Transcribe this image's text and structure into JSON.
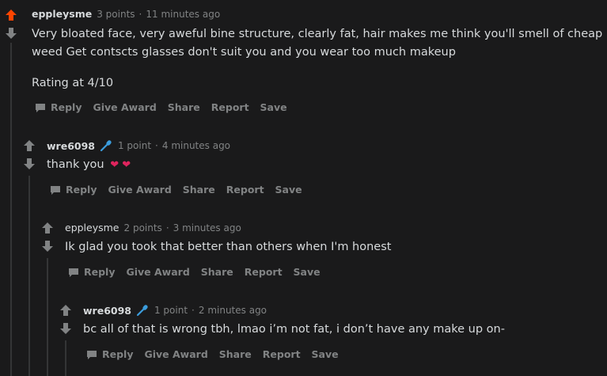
{
  "comments": [
    {
      "user": "eppleysme",
      "points": "3 points",
      "time": "11 minutes ago",
      "lines": [
        "Very bloated face, very aweful bine structure, clearly fat, hair makes me think you'll smell of cheap",
        "weed Get contscts glasses don't suit you and you wear too much makeup",
        "Rating at 4/10"
      ],
      "upvoted": true
    },
    {
      "user": "wre6098",
      "points": "1 point",
      "time": "4 minutes ago",
      "lines": [
        "thank you"
      ],
      "hearts": "❤ ❤",
      "has_mic": true
    },
    {
      "user": "eppleysme",
      "points": "2 points",
      "time": "3 minutes ago",
      "lines": [
        "Ik glad you took that better than others when I'm honest"
      ]
    },
    {
      "user": "wre6098",
      "points": "1 point",
      "time": "2 minutes ago",
      "lines": [
        "bc all of that is wrong tbh, lmao i’m not fat, i don’t have any make up on-"
      ],
      "has_mic": true
    }
  ],
  "actions": {
    "reply": "Reply",
    "give_award": "Give Award",
    "share": "Share",
    "report": "Report",
    "save": "Save"
  },
  "separator": "·",
  "colors": {
    "background": "#1a1a1b",
    "upvote_active": "#ff4500",
    "vote_inactive": "#818384",
    "mic_accent": "#3b9ddd",
    "heart": "#e0245e"
  }
}
